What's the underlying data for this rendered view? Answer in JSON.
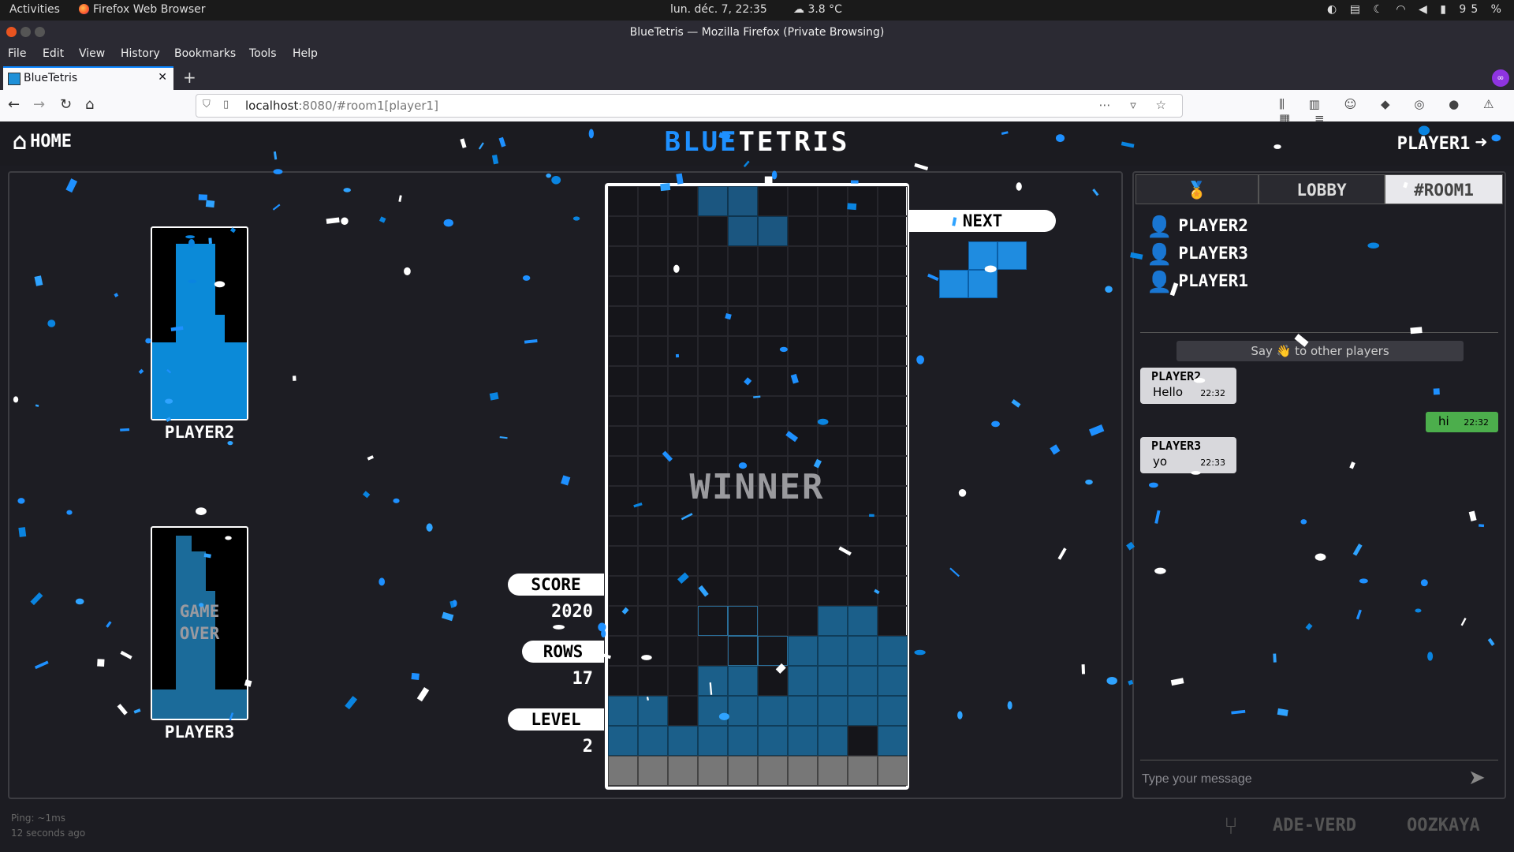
{
  "os": {
    "activities": "Activities",
    "app": "Firefox Web Browser",
    "clock": "lun. déc.  7, 22:35",
    "weather": "3.8 °C",
    "battery": "95 %"
  },
  "browser": {
    "window_title": "BlueTetris — Mozilla Firefox (Private Browsing)",
    "menu": [
      "File",
      "Edit",
      "View",
      "History",
      "Bookmarks",
      "Tools",
      "Help"
    ],
    "tab_title": "BlueTetris",
    "url_host": "localhost",
    "url_rest": ":8080/#room1[player1]"
  },
  "header": {
    "home_label": "HOME",
    "logo_blue": "BLUE",
    "logo_white": "TETRIS",
    "player_label": "PLAYER1"
  },
  "opponents": [
    {
      "name": "PLAYER2",
      "status": ""
    },
    {
      "name": "PLAYER3",
      "status_line1": "GAME",
      "status_line2": "OVER"
    }
  ],
  "board": {
    "banner": "WINNER",
    "columns": 10,
    "rows": 20
  },
  "stats": {
    "score_label": "SCORE",
    "score": "2020",
    "rows_label": "ROWS",
    "rows": "17",
    "level_label": "LEVEL",
    "level": "2"
  },
  "next": {
    "label": "NEXT",
    "piece": "S"
  },
  "sidebar": {
    "tab_icon": "medal-icon",
    "tab_lobby": "LOBBY",
    "tab_room": "#ROOM1",
    "players": [
      "PLAYER2",
      "PLAYER3",
      "PLAYER1"
    ],
    "say_hi": "Say 👋 to other players",
    "messages": [
      {
        "from": "PLAYER2",
        "text": "Hello",
        "time": "22:32"
      },
      {
        "from": "PLAYER3",
        "text": "yo",
        "time": "22:33"
      }
    ],
    "own_message": {
      "text": "hi",
      "time": "22:32"
    },
    "input_placeholder": "Type your message"
  },
  "footer": {
    "ping": "Ping: ~1ms",
    "ago": "12 seconds ago",
    "authors": [
      "ADE-VERD",
      "OOZKAYA"
    ]
  },
  "colors": {
    "accent": "#1e90ff",
    "block": "#1b5f8a",
    "background": "#1c1c22"
  }
}
